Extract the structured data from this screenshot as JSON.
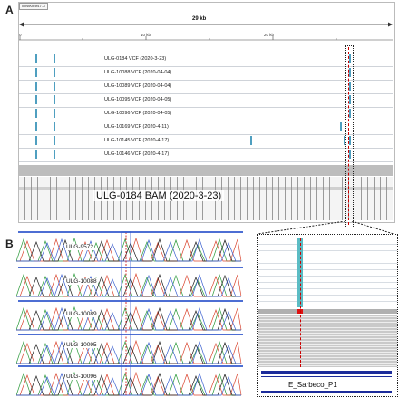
{
  "panel_a": {
    "letter": "A",
    "reference_id": "MN908947.3",
    "span_label": "29 kb",
    "ticks": [
      "0",
      "10 kb",
      "20 kb"
    ],
    "vcf_tracks": [
      {
        "label": "ULG-0184 VCF (2020-3-23)"
      },
      {
        "label": "ULG-10088 VCF (2020-04-04)"
      },
      {
        "label": "ULG-10089 VCF (2020-04-04)"
      },
      {
        "label": "ULG-10095 VCF (2020-04-05)"
      },
      {
        "label": "ULG-10096 VCF (2020-04-05)"
      },
      {
        "label": "ULG-10169 VCF (2020-4-11)"
      },
      {
        "label": "ULG-10145 VCF (2020-4-17)"
      },
      {
        "label": "ULG-10146 VCF (2020-4-17)"
      }
    ],
    "bam_label": "ULG-0184 BAM (2020-3-23)"
  },
  "panel_b": {
    "letter": "B",
    "samples": [
      "ULG-9572",
      "ULG-10088",
      "ULG-10089",
      "ULG-10095",
      "ULG-10096"
    ],
    "zoom_gene_label": "E_Sarbeco_P1"
  }
}
